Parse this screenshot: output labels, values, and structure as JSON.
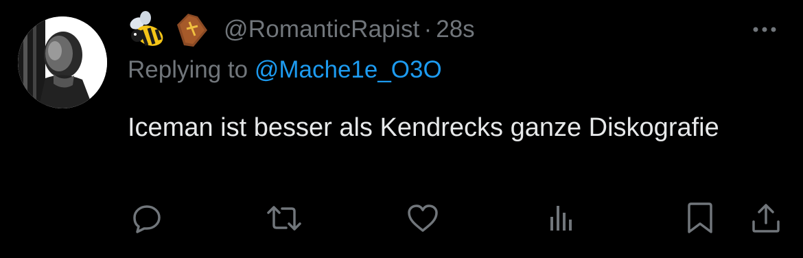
{
  "tweet": {
    "handle": "@RomanticRapist",
    "separator": "·",
    "time": "28s",
    "badges": [
      "bee-emoji",
      "coffin-emoji"
    ],
    "replying_prefix": "Replying to ",
    "replying_to": "@Mache1e_O3O",
    "text": "Iceman ist besser als Kendrecks ganze Diskografie"
  },
  "actions": [
    "reply-icon",
    "retweet-icon",
    "like-icon",
    "views-icon",
    "bookmark-icon",
    "share-icon"
  ],
  "colors": {
    "background": "#000000",
    "text": "#e7e9ea",
    "muted": "#71767b",
    "link": "#1d9bf0"
  }
}
